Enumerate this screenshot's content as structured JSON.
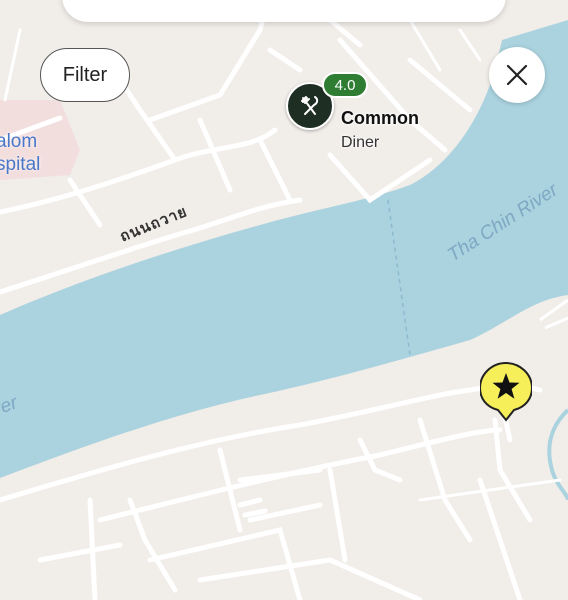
{
  "controls": {
    "filter_label": "Filter"
  },
  "place": {
    "name": "Common",
    "category": "Diner",
    "rating": "4.0"
  },
  "map_labels": {
    "hospital": "alom\nspital",
    "road": "ถนนถวาย",
    "river_main": "Tha Chin River",
    "river_left": "ver"
  },
  "colors": {
    "land": "#f1ede9",
    "water": "#aad3df",
    "road": "#ffffff",
    "marker_dark": "#1e2e22",
    "rating_green": "#2e7d32",
    "favorite_yellow": "#f6ef5a",
    "hospital_blue": "#4a78c8"
  },
  "icons": {
    "place_marker": "fork-knife-icon",
    "close": "close-icon",
    "favorite": "star-icon"
  }
}
